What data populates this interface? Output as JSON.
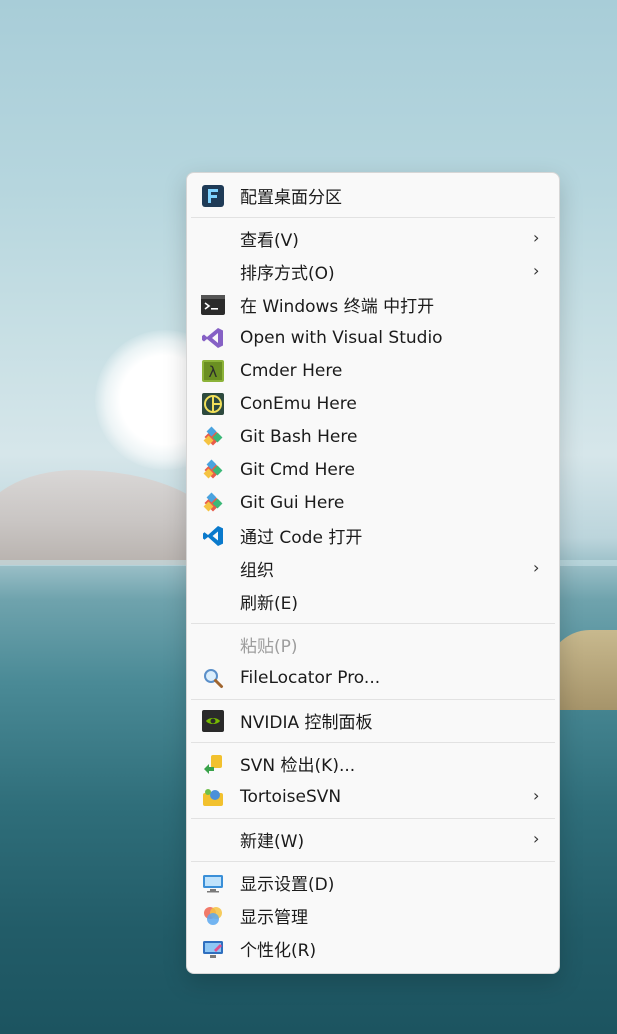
{
  "menu": {
    "items": [
      {
        "label": "配置桌面分区",
        "icon": "fences-icon"
      },
      {
        "label": "查看(V)",
        "submenu": true
      },
      {
        "label": "排序方式(O)",
        "submenu": true
      },
      {
        "label": "在 Windows 终端 中打开",
        "icon": "terminal-icon"
      },
      {
        "label": "Open with Visual Studio",
        "icon": "visual-studio-icon"
      },
      {
        "label": "Cmder Here",
        "icon": "cmder-icon"
      },
      {
        "label": "ConEmu Here",
        "icon": "conemu-icon"
      },
      {
        "label": "Git Bash Here",
        "icon": "git-icon"
      },
      {
        "label": "Git Cmd Here",
        "icon": "git-icon"
      },
      {
        "label": "Git Gui Here",
        "icon": "git-icon"
      },
      {
        "label": "通过 Code 打开",
        "icon": "vscode-icon"
      },
      {
        "label": "组织",
        "submenu": true
      },
      {
        "label": "刷新(E)"
      },
      {
        "label": "粘贴(P)",
        "disabled": true
      },
      {
        "label": "FileLocator Pro...",
        "icon": "magnifier-icon"
      },
      {
        "label": "NVIDIA 控制面板",
        "icon": "nvidia-icon"
      },
      {
        "label": "SVN 检出(K)...",
        "icon": "svn-checkout-icon"
      },
      {
        "label": "TortoiseSVN",
        "icon": "tortoisesvn-icon",
        "submenu": true
      },
      {
        "label": "新建(W)",
        "submenu": true
      },
      {
        "label": "显示设置(D)",
        "icon": "display-settings-icon"
      },
      {
        "label": "显示管理",
        "icon": "display-manager-icon"
      },
      {
        "label": "个性化(R)",
        "icon": "personalize-icon"
      }
    ],
    "submenu_arrow": "›"
  },
  "colors": {
    "menu_bg": "#f9f9f9",
    "text": "#1b1b1b",
    "disabled_text": "#9e9e9e",
    "separator": "#e2e2e2"
  }
}
